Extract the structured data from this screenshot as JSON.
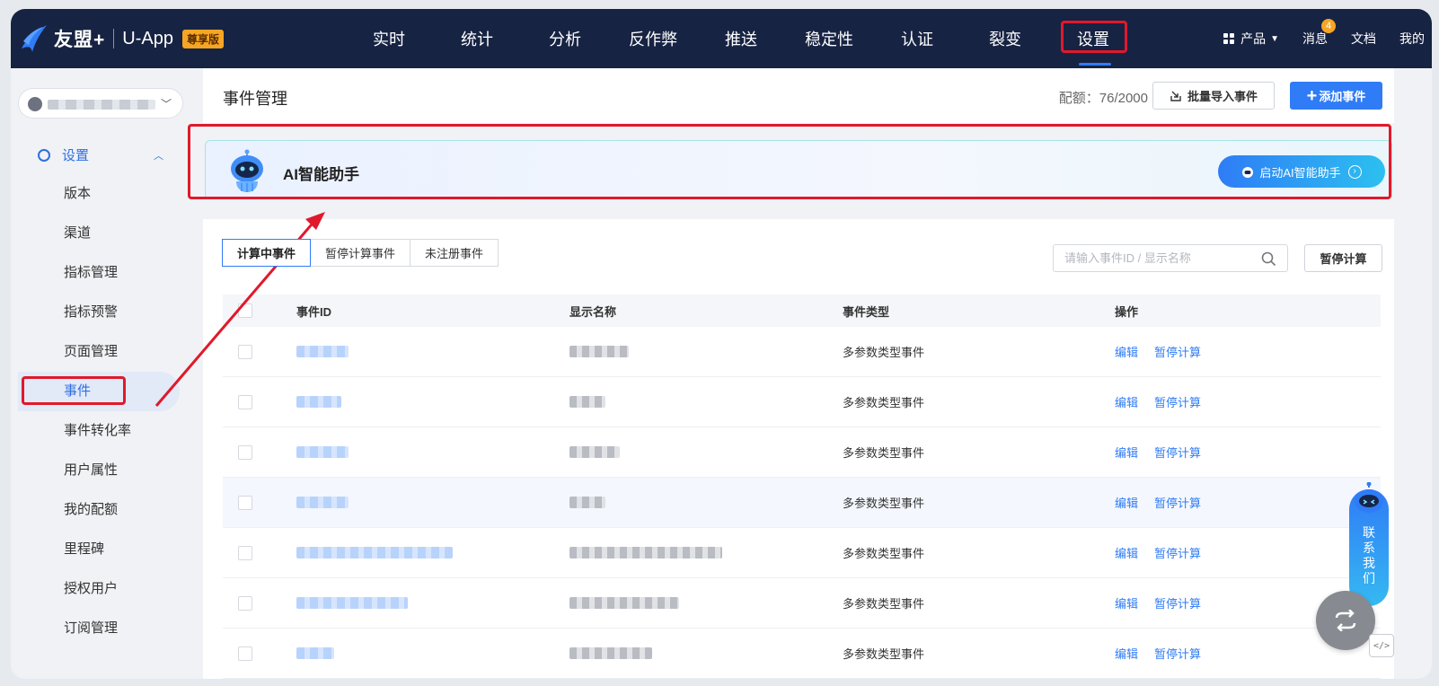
{
  "brand": {
    "name": "友盟+",
    "app": "U-App",
    "badge": "尊享版"
  },
  "nav": [
    {
      "label": "实时",
      "active": false
    },
    {
      "label": "统计",
      "active": false
    },
    {
      "label": "分析",
      "active": false
    },
    {
      "label": "反作弊",
      "active": false
    },
    {
      "label": "推送",
      "active": false
    },
    {
      "label": "稳定性",
      "active": false
    },
    {
      "label": "认证",
      "active": false
    },
    {
      "label": "裂变",
      "active": false
    },
    {
      "label": "设置",
      "active": true
    }
  ],
  "nav_right": {
    "product": "产品",
    "messages": "消息",
    "message_count": "4",
    "docs": "文档",
    "mine": "我的"
  },
  "sidebar": {
    "group": "设置",
    "items": [
      "版本",
      "渠道",
      "指标管理",
      "指标预警",
      "页面管理",
      "事件",
      "事件转化率",
      "用户属性",
      "我的配额",
      "里程碑",
      "授权用户",
      "订阅管理"
    ],
    "active_index": 5
  },
  "header": {
    "title": "事件管理",
    "quota": "配额：76/2000",
    "import_label": "批量导入事件",
    "add_label": "添加事件"
  },
  "ai": {
    "title": "AI智能助手",
    "button": "启动AI智能助手"
  },
  "tabs": [
    "计算中事件",
    "暂停计算事件",
    "未注册事件"
  ],
  "search": {
    "placeholder": "请输入事件ID / 显示名称"
  },
  "pause_button": "暂停计算",
  "table": {
    "headers": [
      "事件ID",
      "显示名称",
      "事件类型",
      "操作"
    ],
    "rows": [
      {
        "type": "多参数类型事件",
        "edit": "编辑",
        "pause": "暂停计算",
        "id_w": 58,
        "name_w": 66
      },
      {
        "type": "多参数类型事件",
        "edit": "编辑",
        "pause": "暂停计算",
        "id_w": 50,
        "name_w": 40
      },
      {
        "type": "多参数类型事件",
        "edit": "编辑",
        "pause": "暂停计算",
        "id_w": 58,
        "name_w": 56
      },
      {
        "type": "多参数类型事件",
        "edit": "编辑",
        "pause": "暂停计算",
        "id_w": 58,
        "name_w": 40
      },
      {
        "type": "多参数类型事件",
        "edit": "编辑",
        "pause": "暂停计算",
        "id_w": 174,
        "name_w": 170
      },
      {
        "type": "多参数类型事件",
        "edit": "编辑",
        "pause": "暂停计算",
        "id_w": 124,
        "name_w": 122
      },
      {
        "type": "多参数类型事件",
        "edit": "编辑",
        "pause": "暂停计算",
        "id_w": 42,
        "name_w": 92
      }
    ]
  },
  "contact": "联系我们",
  "colors": {
    "accent": "#2f7cf6",
    "nav_bg": "#172343",
    "highlight": "#e0192b"
  }
}
